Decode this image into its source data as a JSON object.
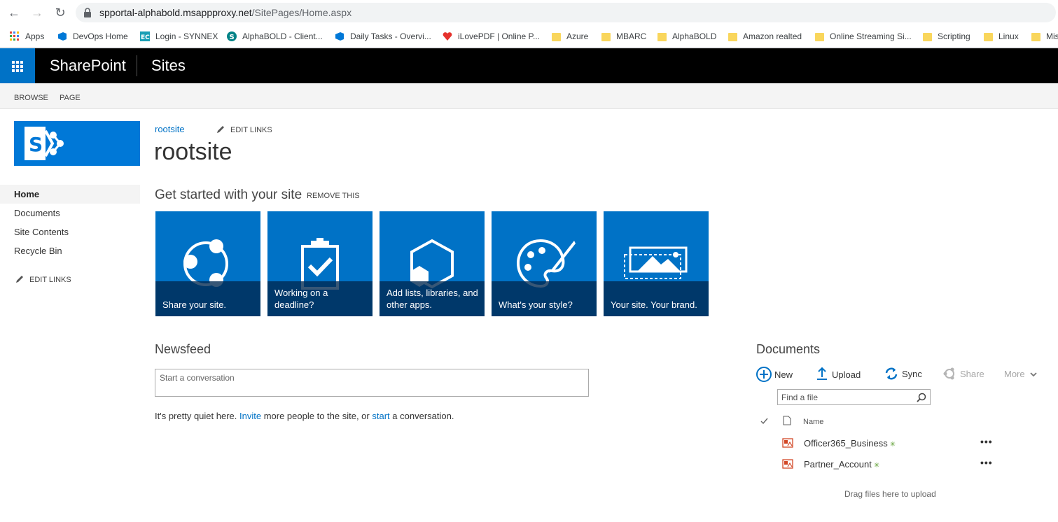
{
  "browser": {
    "url_host": "spportal-alphabold.msappproxy.net",
    "url_path": "/SitePages/Home.aspx",
    "bookmarks": [
      {
        "label": "Apps",
        "icon": "apps-grid-icon"
      },
      {
        "label": "DevOps Home",
        "icon": "devops-icon"
      },
      {
        "label": "Login - SYNNEX",
        "icon": "ec-icon"
      },
      {
        "label": "AlphaBOLD - Client...",
        "icon": "sharepoint-icon"
      },
      {
        "label": "Daily Tasks - Overvi...",
        "icon": "devops-icon"
      },
      {
        "label": "iLovePDF | Online P...",
        "icon": "heart-icon"
      },
      {
        "label": "Azure",
        "icon": "folder-icon"
      },
      {
        "label": "MBARC",
        "icon": "folder-icon"
      },
      {
        "label": "AlphaBOLD",
        "icon": "folder-icon"
      },
      {
        "label": "Amazon realted",
        "icon": "folder-icon"
      },
      {
        "label": "Online Streaming Si...",
        "icon": "folder-icon"
      },
      {
        "label": "Scripting",
        "icon": "folder-icon"
      },
      {
        "label": "Linux",
        "icon": "folder-icon"
      },
      {
        "label": "Mis",
        "icon": "folder-icon"
      }
    ]
  },
  "suite": {
    "brand": "SharePoint",
    "sites": "Sites"
  },
  "ribbon": {
    "tabs": [
      "BROWSE",
      "PAGE"
    ]
  },
  "left_nav": {
    "items": [
      "Home",
      "Documents",
      "Site Contents",
      "Recycle Bin"
    ],
    "edit_links": "EDIT LINKS"
  },
  "header": {
    "breadcrumb": "rootsite",
    "edit_links": "EDIT LINKS",
    "title": "rootsite"
  },
  "get_started": {
    "title": "Get started with your site",
    "remove": "REMOVE THIS",
    "tiles": [
      {
        "label": "Share your site.",
        "icon": "share-icon"
      },
      {
        "label": "Working on a deadline?",
        "icon": "clipboard-check-icon"
      },
      {
        "label": "Add lists, libraries, and other apps.",
        "icon": "hexagon-icon"
      },
      {
        "label": "What's your style?",
        "icon": "palette-icon"
      },
      {
        "label": "Your site. Your brand.",
        "icon": "picture-icon"
      }
    ]
  },
  "newsfeed": {
    "title": "Newsfeed",
    "placeholder": "Start a conversation",
    "quiet_1": "It's pretty quiet here.",
    "invite": "Invite",
    "quiet_2": "more people to the site, or",
    "start": "start",
    "quiet_3": "a conversation."
  },
  "documents": {
    "title": "Documents",
    "commands": {
      "new": "New",
      "upload": "Upload",
      "sync": "Sync",
      "share": "Share",
      "more": "More"
    },
    "find_placeholder": "Find a file",
    "name_header": "Name",
    "files": [
      "Officer365_Business",
      "Partner_Account"
    ],
    "drag_text": "Drag files here to upload"
  },
  "colors": {
    "accent": "#0072c6",
    "suite_bar": "#000000",
    "tile_caption": "#002850"
  }
}
